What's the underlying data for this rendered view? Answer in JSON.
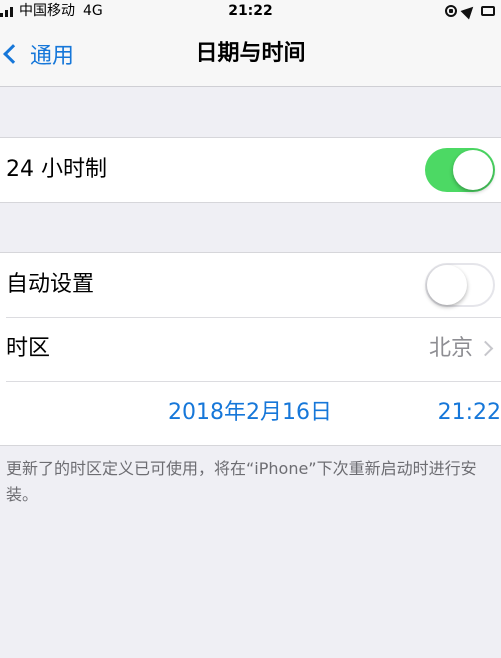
{
  "status_bar": {
    "carrier": "中国移动",
    "network": "4G",
    "time": "21:22"
  },
  "nav": {
    "back_label": "通用",
    "title": "日期与时间"
  },
  "settings": {
    "hour24": {
      "label": "24 小时制",
      "state": "on"
    },
    "auto_set": {
      "label": "自动设置",
      "state": "off"
    },
    "timezone": {
      "label": "时区",
      "value": "北京"
    },
    "date": "2018年2月16日",
    "time": "21:22"
  },
  "footnote": "更新了的时区定义已可使用，将在“iPhone”下次重新启动时进行安装。",
  "colors": {
    "accent": "#1677d9",
    "toggle_on": "#4cd964",
    "background": "#efeff4"
  }
}
